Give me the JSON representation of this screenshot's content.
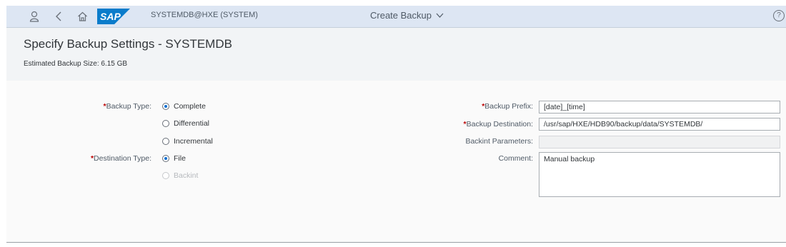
{
  "shell": {
    "system": "SYSTEMDB@HXE (SYSTEM)",
    "app_title": "Create Backup",
    "logo_text": "SAP",
    "help": "?"
  },
  "header": {
    "title": "Specify Backup Settings - SYSTEMDB",
    "estimated_size": "Estimated Backup Size: 6.15 GB"
  },
  "form": {
    "backup_type_label": "Backup Type:",
    "backup_type_options": [
      "Complete",
      "Differential",
      "Incremental"
    ],
    "backup_type_selected": "Complete",
    "destination_type_label": "Destination Type:",
    "destination_type_options": [
      "File",
      "Backint"
    ],
    "destination_type_selected": "File",
    "backup_prefix_label": "Backup Prefix:",
    "backup_prefix_value": "[date]_[time]",
    "backup_destination_label": "Backup Destination:",
    "backup_destination_value": "/usr/sap/HXE/HDB90/backup/data/SYSTEMDB/",
    "backint_params_label": "Backint Parameters:",
    "backint_params_value": "",
    "comment_label": "Comment:",
    "comment_value": "Manual backup",
    "required_marker": "*"
  },
  "colors": {
    "shellbar": "#dde6f3",
    "header_bg": "#f2f4f6",
    "required": "#bb0000",
    "radio_selected": "#0a6ed1",
    "sap_logo": "#0a7ccb"
  }
}
